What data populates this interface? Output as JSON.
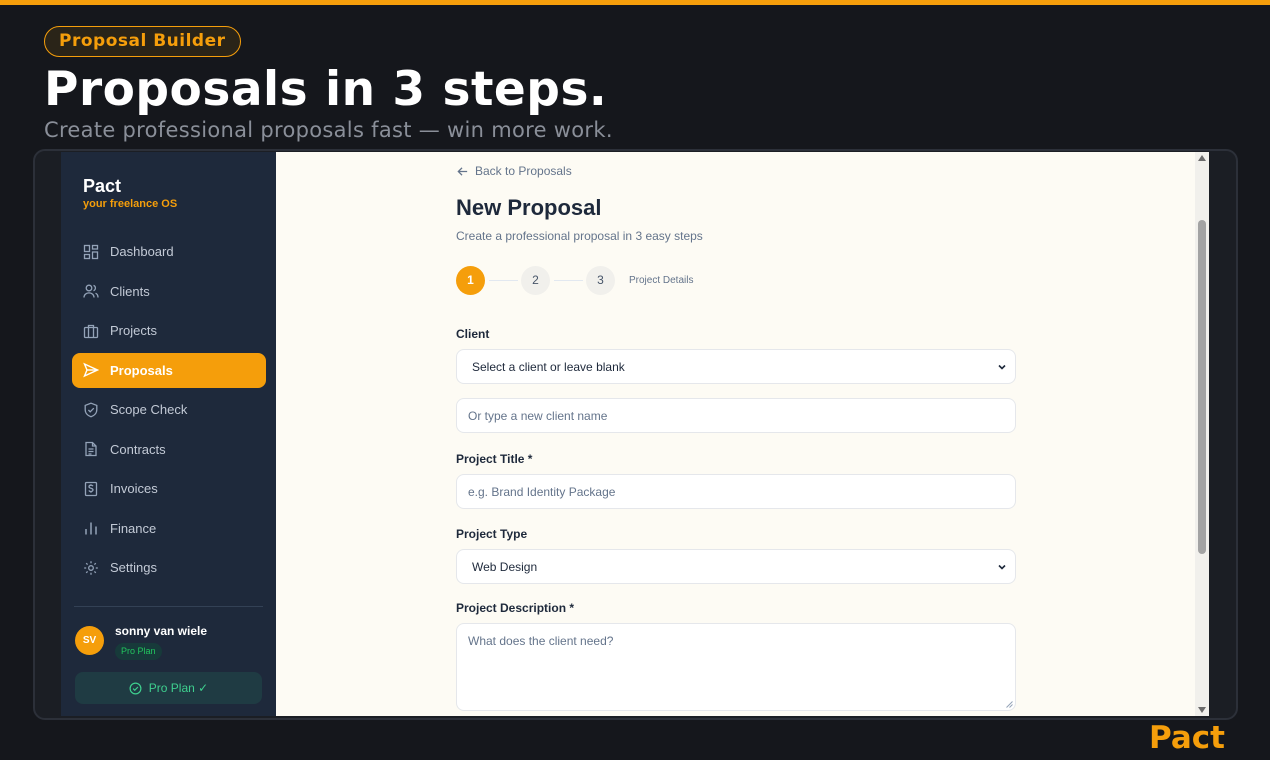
{
  "banner": {
    "pill": "Proposal Builder",
    "headline": "Proposals in 3 steps.",
    "subline": "Create professional proposals fast — win more work.",
    "brand": "Pact"
  },
  "colors": {
    "accent": "#f59e0b",
    "sidebar": "#1e293b",
    "page_bg": "#fdfbf4",
    "outer_bg": "#15171c"
  },
  "sidebar": {
    "logo": "Pact",
    "tagline": "your freelance OS",
    "items": [
      {
        "label": "Dashboard",
        "icon": "dashboard-icon"
      },
      {
        "label": "Clients",
        "icon": "users-icon"
      },
      {
        "label": "Projects",
        "icon": "briefcase-icon"
      },
      {
        "label": "Proposals",
        "icon": "send-icon",
        "active": true
      },
      {
        "label": "Scope Check",
        "icon": "shield-check-icon"
      },
      {
        "label": "Contracts",
        "icon": "document-icon"
      },
      {
        "label": "Invoices",
        "icon": "receipt-dollar-icon"
      },
      {
        "label": "Finance",
        "icon": "bar-chart-icon"
      },
      {
        "label": "Settings",
        "icon": "gear-icon"
      }
    ],
    "user": {
      "initials": "SV",
      "name": "sonny van wiele",
      "plan": "Pro Plan"
    },
    "pro_button": "Pro Plan ✓"
  },
  "main": {
    "back_link": "Back to Proposals",
    "title": "New Proposal",
    "description": "Create a professional proposal in 3 easy steps",
    "steps": [
      "1",
      "2",
      "3"
    ],
    "current_step": 1,
    "step_label": "Project Details",
    "form": {
      "client_label": "Client",
      "client_select_value": "Select a client or leave blank",
      "client_new_placeholder": "Or type a new client name",
      "project_title_label": "Project Title *",
      "project_title_placeholder": "e.g. Brand Identity Package",
      "project_type_label": "Project Type",
      "project_type_value": "Web Design",
      "project_description_label": "Project Description *",
      "project_description_placeholder": "What does the client need?"
    }
  }
}
